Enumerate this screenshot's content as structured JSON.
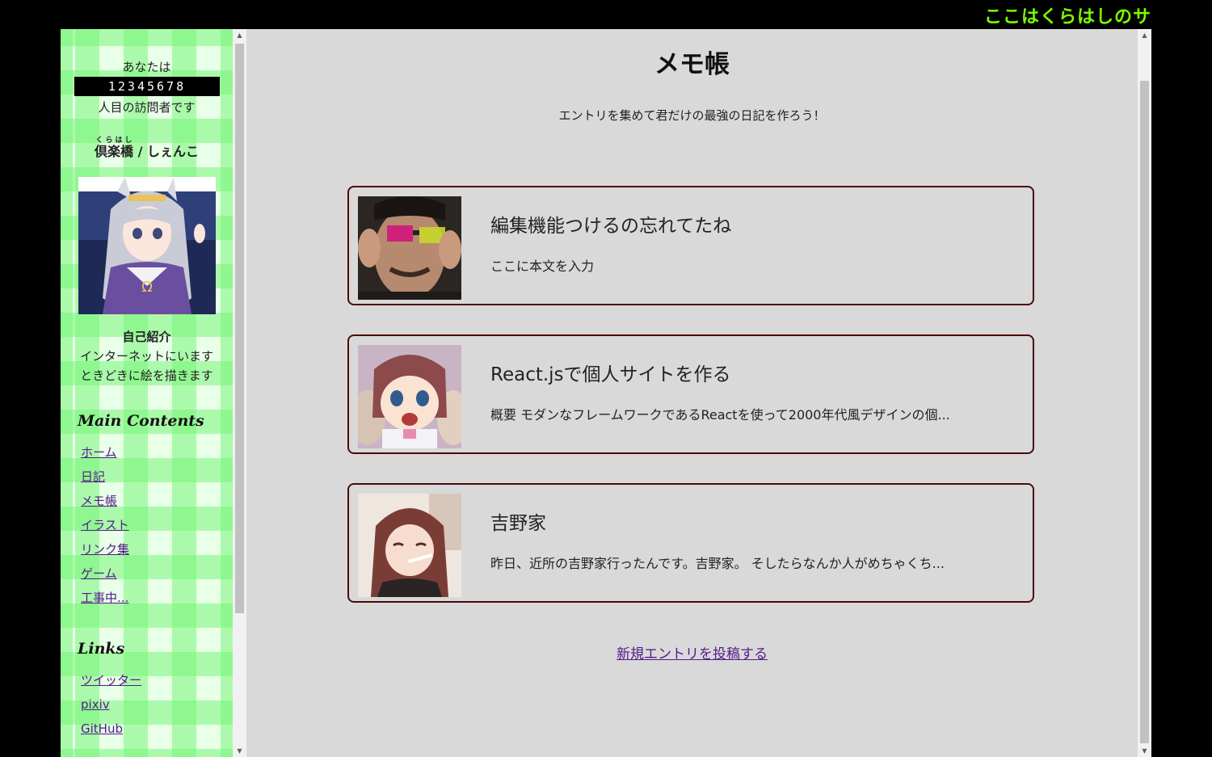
{
  "marquee": {
    "text": "ここはくらはしのサ"
  },
  "sidebar": {
    "visitor_prefix": "あなたは",
    "counter": "12345678",
    "visitor_suffix": "人目の訪問者です",
    "name_base": "倶楽橋",
    "name_ruby": "くらはし",
    "name_rest": " / しぇんこ",
    "intro_title": "自己紹介",
    "intro_lines": [
      "インターネットにいます",
      "ときどきに絵を描きます"
    ],
    "main_heading": "Main Contents",
    "main_links": [
      "ホーム",
      "日記",
      "メモ帳",
      "イラスト",
      "リンク集",
      "ゲーム",
      "工事中..."
    ],
    "links_heading": "Links",
    "ext_links": [
      "ツイッター",
      "pixiv",
      "GitHub"
    ]
  },
  "main": {
    "title": "メモ帳",
    "subtitle": "エントリを集めて君だけの最強の日記を作ろう！",
    "entries": [
      {
        "title": "編集機能つけるの忘れてたね",
        "body": "ここに本文を入力",
        "icon": "glasses-photo"
      },
      {
        "title": "React.jsで個人サイトを作る",
        "body": "概要 モダンなフレームワークであるReactを使って2000年代風デザインの個...",
        "icon": "anime-girl-surprised"
      },
      {
        "title": "吉野家",
        "body": "昨日、近所の吉野家行ったんです。吉野家。 そしたらなんか人がめちゃくち...",
        "icon": "anime-girl-cigarette"
      }
    ],
    "new_entry_label": "新規エントリを投稿する"
  },
  "colors": {
    "accent_green": "#7cfc00",
    "card_border": "#4a0a0a",
    "link": "#551a8b",
    "main_bg": "#d9d9d9"
  }
}
